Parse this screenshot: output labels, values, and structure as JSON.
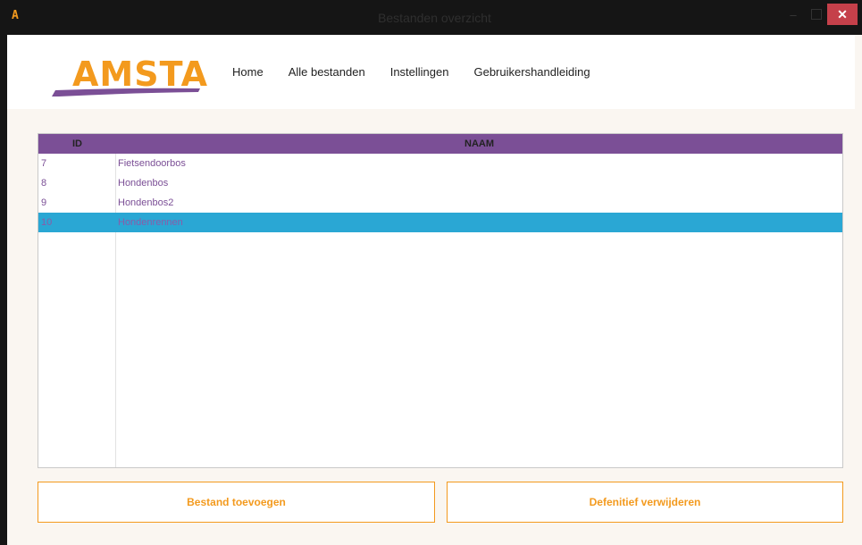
{
  "window": {
    "title": "Bestanden overzicht",
    "app_icon": "A",
    "controls": {
      "minimize": "–",
      "close": "✕"
    }
  },
  "header": {
    "logo_text": "AMSTA",
    "nav": [
      {
        "label": "Home"
      },
      {
        "label": "Alle bestanden"
      },
      {
        "label": "Instellingen"
      },
      {
        "label": "Gebruikershandleiding"
      }
    ]
  },
  "table": {
    "columns": {
      "id": "ID",
      "name": "NAAM"
    },
    "rows": [
      {
        "id": "7",
        "name": "Fietsendoorbos",
        "selected": false
      },
      {
        "id": "8",
        "name": "Hondenbos",
        "selected": false
      },
      {
        "id": "9",
        "name": "Hondenbos2",
        "selected": false
      },
      {
        "id": "10",
        "name": "Hondenrennen",
        "selected": true
      }
    ]
  },
  "buttons": {
    "add": "Bestand toevoegen",
    "delete": "Defenitief verwijderen"
  },
  "colors": {
    "accent": "#f39a1e",
    "header_purple": "#7b4f96",
    "selection_blue": "#2aa7d4",
    "close_red": "#c5404a"
  }
}
